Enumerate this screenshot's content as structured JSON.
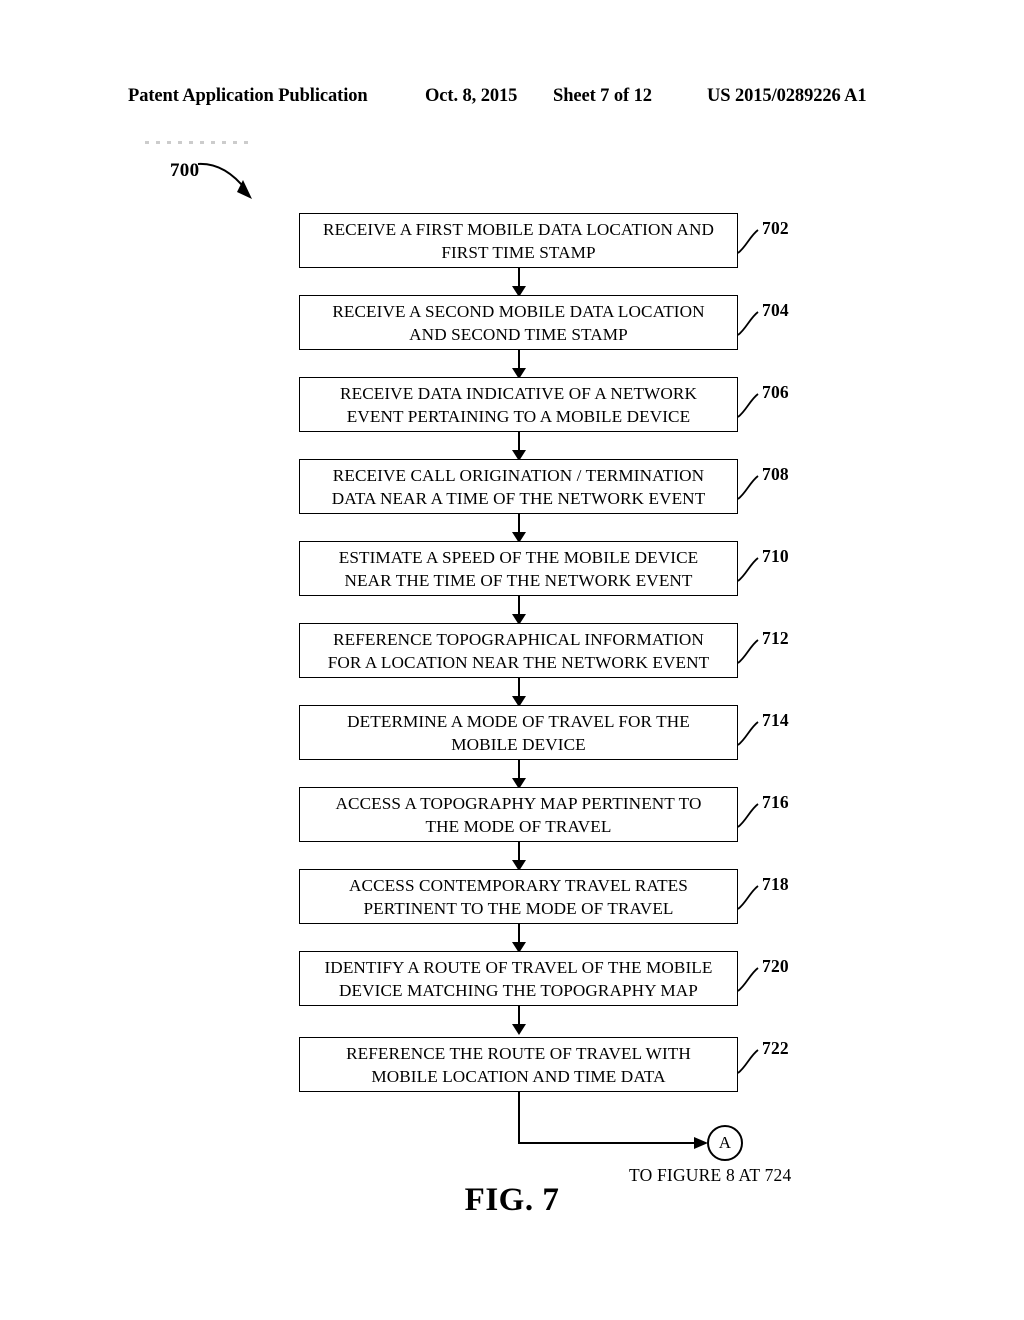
{
  "header": {
    "publication": "Patent Application Publication",
    "date": "Oct. 8, 2015",
    "sheet": "Sheet 7 of 12",
    "patent_number": "US 2015/0289226 A1"
  },
  "figure": {
    "flow_tag": "700",
    "caption": "FIG. 7",
    "caption_prefix": "FIG.",
    "caption_number": "7"
  },
  "flowchart": {
    "type": "flowchart",
    "orientation": "vertical",
    "steps": [
      {
        "ref": "702",
        "text": "RECEIVE A FIRST MOBILE DATA LOCATION AND\nFIRST TIME STAMP"
      },
      {
        "ref": "704",
        "text": "RECEIVE A SECOND MOBILE DATA LOCATION\nAND SECOND TIME STAMP"
      },
      {
        "ref": "706",
        "text": "RECEIVE DATA INDICATIVE OF A NETWORK\nEVENT PERTAINING TO A MOBILE DEVICE"
      },
      {
        "ref": "708",
        "text": "RECEIVE CALL ORIGINATION / TERMINATION\nDATA NEAR A TIME OF THE NETWORK EVENT"
      },
      {
        "ref": "710",
        "text": "ESTIMATE A SPEED OF THE MOBILE DEVICE\nNEAR THE TIME OF THE NETWORK EVENT"
      },
      {
        "ref": "712",
        "text": "REFERENCE TOPOGRAPHICAL INFORMATION\nFOR A LOCATION NEAR THE NETWORK EVENT"
      },
      {
        "ref": "714",
        "text": "DETERMINE A MODE OF TRAVEL FOR THE\nMOBILE DEVICE"
      },
      {
        "ref": "716",
        "text": "ACCESS A TOPOGRAPHY MAP PERTINENT TO\nTHE MODE OF TRAVEL"
      },
      {
        "ref": "718",
        "text": "ACCESS CONTEMPORARY TRAVEL RATES\nPERTINENT TO THE MODE OF TRAVEL"
      },
      {
        "ref": "720",
        "text": "IDENTIFY A ROUTE OF TRAVEL OF THE MOBILE\nDEVICE MATCHING THE TOPOGRAPHY MAP"
      },
      {
        "ref": "722",
        "text": "REFERENCE THE ROUTE OF TRAVEL WITH\nMOBILE LOCATION AND TIME DATA"
      }
    ],
    "connector": {
      "label": "A",
      "caption": "TO FIGURE 8 AT 724"
    }
  },
  "colors": {
    "ink": "#000000",
    "paper": "#ffffff"
  }
}
